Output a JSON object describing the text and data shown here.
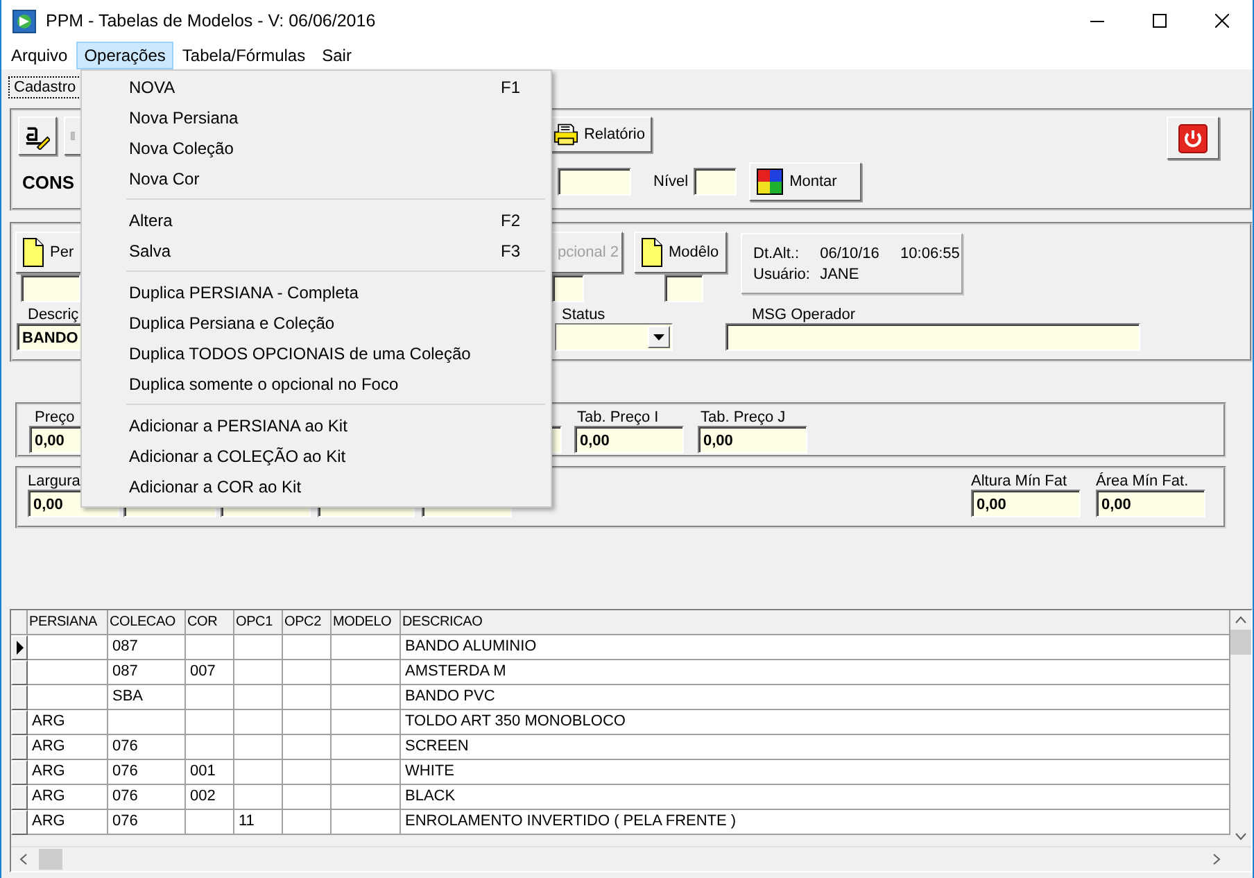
{
  "window": {
    "title": "PPM - Tabelas de Modelos - V: 06/06/2016"
  },
  "menubar": [
    {
      "label": "Arquivo",
      "selected": false
    },
    {
      "label": "Operações",
      "selected": true
    },
    {
      "label": "Tabela/Fórmulas",
      "selected": false
    },
    {
      "label": "Sair",
      "selected": false
    }
  ],
  "tabs": [
    {
      "label": "Cadastro",
      "selected": true
    }
  ],
  "header_panel": {
    "report_button": "Relatório",
    "mode_label": "CONS",
    "level_label": "Nível",
    "build_button": "Montar"
  },
  "record_panel": {
    "buttons": [
      {
        "label": "Per",
        "disabled": false
      },
      {
        "label": "pcional 2",
        "disabled": true
      },
      {
        "label": "Modêlo",
        "disabled": false
      }
    ],
    "info": {
      "date_label": "Dt.Alt.:",
      "date": "06/10/16",
      "time": "10:06:55",
      "user_label": "Usuário:",
      "user": "JANE"
    },
    "description_label": "Descriç",
    "description": "BANDO",
    "status_label": "Status",
    "message_label": "MSG Operador"
  },
  "price_panel": {
    "fields": [
      {
        "label": "Preço",
        "value": "0,00"
      },
      {
        "label": "Tab. Preço I",
        "value": "0,00"
      },
      {
        "label": "Tab. Preço J",
        "value": "0,00"
      }
    ]
  },
  "size_panel": {
    "left": {
      "label": "Largura",
      "value": "0,00"
    },
    "right": [
      {
        "label": "Altura Mín Fat",
        "value": "0,00"
      },
      {
        "label": "Área Mín Fat.",
        "value": "0,00"
      }
    ]
  },
  "open_menu": {
    "sections": [
      [
        {
          "label": "NOVA",
          "shortcut": "F1"
        },
        {
          "label": "Nova Persiana"
        },
        {
          "label": "Nova Coleção"
        },
        {
          "label": "Nova Cor"
        }
      ],
      [
        {
          "label": "Altera",
          "shortcut": "F2"
        },
        {
          "label": "Salva",
          "shortcut": "F3"
        }
      ],
      [
        {
          "label": "Duplica PERSIANA - Completa"
        },
        {
          "label": "Duplica Persiana e Coleção"
        },
        {
          "label": "Duplica TODOS OPCIONAIS de uma  Coleção"
        },
        {
          "label": "Duplica somente o opcional no Foco"
        }
      ],
      [
        {
          "label": "Adicionar a PERSIANA ao Kit"
        },
        {
          "label": "Adicionar a COLEÇÃO ao Kit"
        },
        {
          "label": "Adicionar a COR ao Kit"
        }
      ]
    ]
  },
  "table": {
    "columns": [
      "PERSIANA",
      "COLECAO",
      "COR",
      "OPC1",
      "OPC2",
      "MODELO",
      "DESCRICAO"
    ],
    "rows": [
      {
        "selected": true,
        "cells": [
          "",
          "087",
          "",
          "",
          "",
          "",
          "BANDO ALUMINIO"
        ]
      },
      {
        "selected": false,
        "cells": [
          "",
          "087",
          "007",
          "",
          "",
          "",
          "AMSTERDA M"
        ]
      },
      {
        "selected": false,
        "cells": [
          "",
          "SBA",
          "",
          "",
          "",
          "",
          "BANDO PVC"
        ]
      },
      {
        "selected": false,
        "cells": [
          "ARG",
          "",
          "",
          "",
          "",
          "",
          "TOLDO ART 350 MONOBLOCO"
        ]
      },
      {
        "selected": false,
        "cells": [
          "ARG",
          "076",
          "",
          "",
          "",
          "",
          "SCREEN"
        ]
      },
      {
        "selected": false,
        "cells": [
          "ARG",
          "076",
          "001",
          "",
          "",
          "",
          "WHITE"
        ]
      },
      {
        "selected": false,
        "cells": [
          "ARG",
          "076",
          "002",
          "",
          "",
          "",
          "BLACK"
        ]
      },
      {
        "selected": false,
        "cells": [
          "ARG",
          "076",
          "",
          "11",
          "",
          "",
          "ENROLAMENTO INVERTIDO ( PELA FRENTE )"
        ]
      }
    ]
  }
}
